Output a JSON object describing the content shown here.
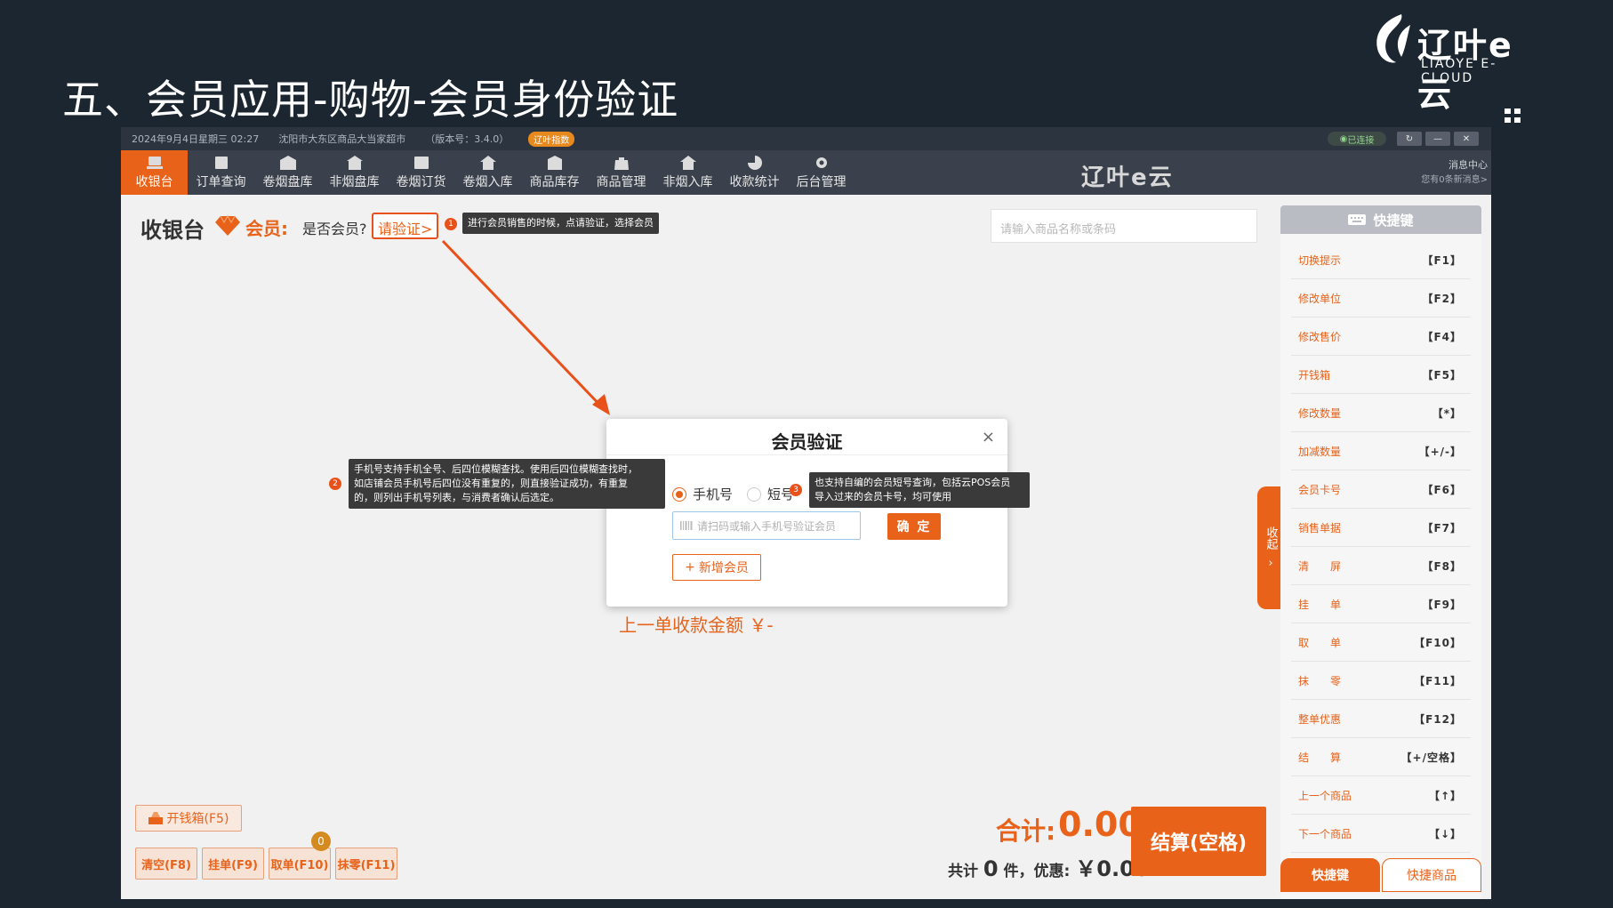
{
  "slide": {
    "title": "五、会员应用-购物-会员身份验证",
    "logo_text": "辽叶e云",
    "logo_sub": "LIAOYE E-CLOUD"
  },
  "status_bar": {
    "datetime": "2024年9月4日星期三 02:27",
    "store": "沈阳市大东区商品大当家超市",
    "version": "（版本号：3.4.0）",
    "tag": "辽叶指数",
    "wifi": "已连接"
  },
  "nav": {
    "items": [
      {
        "label": "收银台",
        "icon": "cashier-icon",
        "active": true
      },
      {
        "label": "订单查询",
        "icon": "order-icon"
      },
      {
        "label": "卷烟盘库",
        "icon": "inventory-icon"
      },
      {
        "label": "非烟盘库",
        "icon": "warehouse-icon"
      },
      {
        "label": "卷烟订货",
        "icon": "edit-icon"
      },
      {
        "label": "卷烟入库",
        "icon": "home-in-icon"
      },
      {
        "label": "商品库存",
        "icon": "stock-icon"
      },
      {
        "label": "商品管理",
        "icon": "bag-icon"
      },
      {
        "label": "非烟入库",
        "icon": "home-icon"
      },
      {
        "label": "收款统计",
        "icon": "pie-icon"
      },
      {
        "label": "后台管理",
        "icon": "gear-icon"
      }
    ],
    "brand": "辽叶e云",
    "message_center": "消息中心",
    "message_sub": "您有0条新消息>"
  },
  "cashier": {
    "title": "收银台",
    "member_label": "会员:",
    "member_question": "是否会员?",
    "verify_link": "请验证>",
    "search_placeholder": "请输入商品名称或条码",
    "prev_amount": "上一单收款金额 ￥-"
  },
  "annotations": {
    "a1_num": "1",
    "a1_text": "进行会员销售的时候，点请验证，选择会员",
    "a2_num": "2",
    "a2_line1": "手机号支持手机全号、后四位模糊查找。使用后四位模糊查找时，",
    "a2_line2": "如店铺会员手机号后四位没有重复的，则直接验证成功，有重复",
    "a2_line3": "的，则列出手机号列表，与消费者确认后选定。",
    "a3_num": "3",
    "a3_line1": "也支持自编的会员短号查询，包括云POS会员",
    "a3_line2": "导入过来的会员卡号，均可使用"
  },
  "modal": {
    "title": "会员验证",
    "radio_phone": "手机号",
    "radio_short": "短号",
    "input_placeholder": "请扫码或输入手机号验证会员",
    "confirm": "确 定",
    "add_member": "新增会员"
  },
  "collapse_tab": {
    "label": "收起"
  },
  "shortcuts": {
    "header": "快捷键",
    "items": [
      {
        "name": "切换提示",
        "key": "【F1】"
      },
      {
        "name": "修改单位",
        "key": "【F2】"
      },
      {
        "name": "修改售价",
        "key": "【F4】"
      },
      {
        "name": "开钱箱",
        "key": "【F5】"
      },
      {
        "name": "修改数量",
        "key": "【*】"
      },
      {
        "name": "加减数量",
        "key": "【+/-】"
      },
      {
        "name": "会员卡号",
        "key": "【F6】"
      },
      {
        "name": "销售单据",
        "key": "【F7】"
      },
      {
        "name": "清　　屏",
        "key": "【F8】"
      },
      {
        "name": "挂　　单",
        "key": "【F9】"
      },
      {
        "name": "取　　单",
        "key": "【F10】"
      },
      {
        "name": "抹　　零",
        "key": "【F11】"
      },
      {
        "name": "整单优惠",
        "key": "【F12】"
      },
      {
        "name": "结　　算",
        "key": "【+/空格】"
      },
      {
        "name": "上一个商品",
        "key": "【↑】"
      },
      {
        "name": "下一个商品",
        "key": "【↓】"
      }
    ],
    "tab_active": "快捷键",
    "tab_inactive": "快捷商品"
  },
  "bottom": {
    "open_drawer": "开钱箱(F5)",
    "clear": "清空(F8)",
    "hang": "挂单(F9)",
    "take": "取单(F10)",
    "round": "抹零(F11)",
    "badge": "0",
    "total_label": "合计:",
    "total_value": "0.00",
    "summary_prefix": "共计",
    "count": "0",
    "summary_mid": "件，优惠:",
    "discount": "￥0.00",
    "checkout": "结算(空格)"
  },
  "colors": {
    "accent": "#e8621a",
    "nav_bg": "#3a414c",
    "slide_bg": "#1b2630"
  }
}
